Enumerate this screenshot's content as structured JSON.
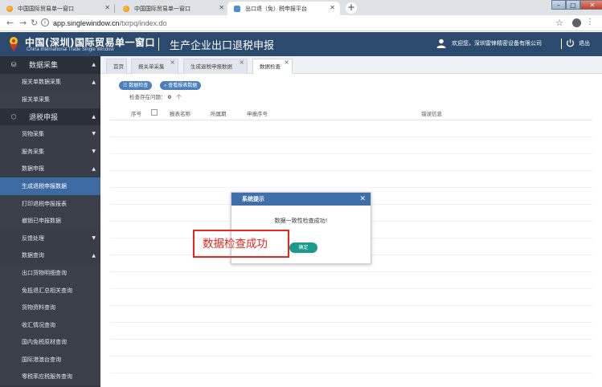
{
  "browser": {
    "tabs": [
      {
        "title": "中国国际贸易单一窗口",
        "active": false
      },
      {
        "title": "中国国际贸易单一窗口",
        "active": false
      },
      {
        "title": "出口退（免）税申报平台",
        "active": true
      }
    ],
    "new_tab": "+",
    "url_host": "app.singlewindow.cn",
    "url_path": "/txrpq/index.do",
    "window_controls": {
      "minimize": "–",
      "maximize": "□",
      "close": "✕"
    }
  },
  "header": {
    "brand_cn": "中国(深圳)国际贸易单一窗口",
    "brand_en": "China International Trade Single Window",
    "app_title": "生产企业出口退税申报",
    "welcome": "欢迎您，深圳雷锋精密设备有限公司",
    "logout": "退出",
    "colors": {
      "header_bg": "#2c4a6e",
      "sidebar_bg": "#333841",
      "active": "#3e6aa3"
    }
  },
  "sidebar": {
    "items": [
      {
        "label": "数据采集",
        "kind": "group",
        "icon": "db-icon",
        "caret": "▲"
      },
      {
        "label": "报关单数据采集",
        "kind": "sub",
        "caret": "▲"
      },
      {
        "label": "报关单采集",
        "kind": "sub2",
        "caret": ""
      },
      {
        "label": "退税申报",
        "kind": "group",
        "icon": "cube-icon",
        "caret": "▲"
      },
      {
        "label": "货物采集",
        "kind": "sub",
        "caret": "▼"
      },
      {
        "label": "服务采集",
        "kind": "sub",
        "caret": "▼"
      },
      {
        "label": "数据申报",
        "kind": "sub",
        "caret": "▲"
      },
      {
        "label": "生成退税申报数据",
        "kind": "active",
        "caret": ""
      },
      {
        "label": "打印退税申报报表",
        "kind": "sub2",
        "caret": ""
      },
      {
        "label": "撤销已申报数据",
        "kind": "sub2",
        "caret": ""
      },
      {
        "label": "反馈处理",
        "kind": "sub",
        "caret": "▼"
      },
      {
        "label": "数据查询",
        "kind": "sub",
        "caret": "▲"
      },
      {
        "label": "出口货物明细查询",
        "kind": "sub2",
        "caret": ""
      },
      {
        "label": "免抵退汇总相关查询",
        "kind": "sub2",
        "caret": ""
      },
      {
        "label": "货物资料查询",
        "kind": "sub2",
        "caret": ""
      },
      {
        "label": "收汇情况查询",
        "kind": "sub2",
        "caret": ""
      },
      {
        "label": "国内免税原材查询",
        "kind": "sub2",
        "caret": ""
      },
      {
        "label": "国际港澳台查询",
        "kind": "sub2",
        "caret": ""
      },
      {
        "label": "零税率应税服务查询",
        "kind": "sub2",
        "caret": ""
      }
    ]
  },
  "page_tabs": [
    {
      "label": "首页",
      "closable": false,
      "active": false
    },
    {
      "label": "报关单采集",
      "closable": true,
      "active": false
    },
    {
      "label": "生成退税申报数据",
      "closable": true,
      "active": false
    },
    {
      "label": "数据检查",
      "closable": true,
      "active": true
    }
  ],
  "toolbar": {
    "check_button": "数据检查",
    "view_report_button": "查看报表数据"
  },
  "summary": {
    "issue_label": "检查存在问题：",
    "issue_count": "0",
    "issue_unit": "个"
  },
  "table": {
    "columns": [
      "序号",
      "报表名称",
      "所属期",
      "申报序号",
      "错误信息"
    ]
  },
  "modal": {
    "title": "系统提示",
    "close": "✕",
    "message": "数据一致性检查成功!",
    "ok_button": "确定"
  },
  "annotation": {
    "text": "数据检查成功"
  }
}
